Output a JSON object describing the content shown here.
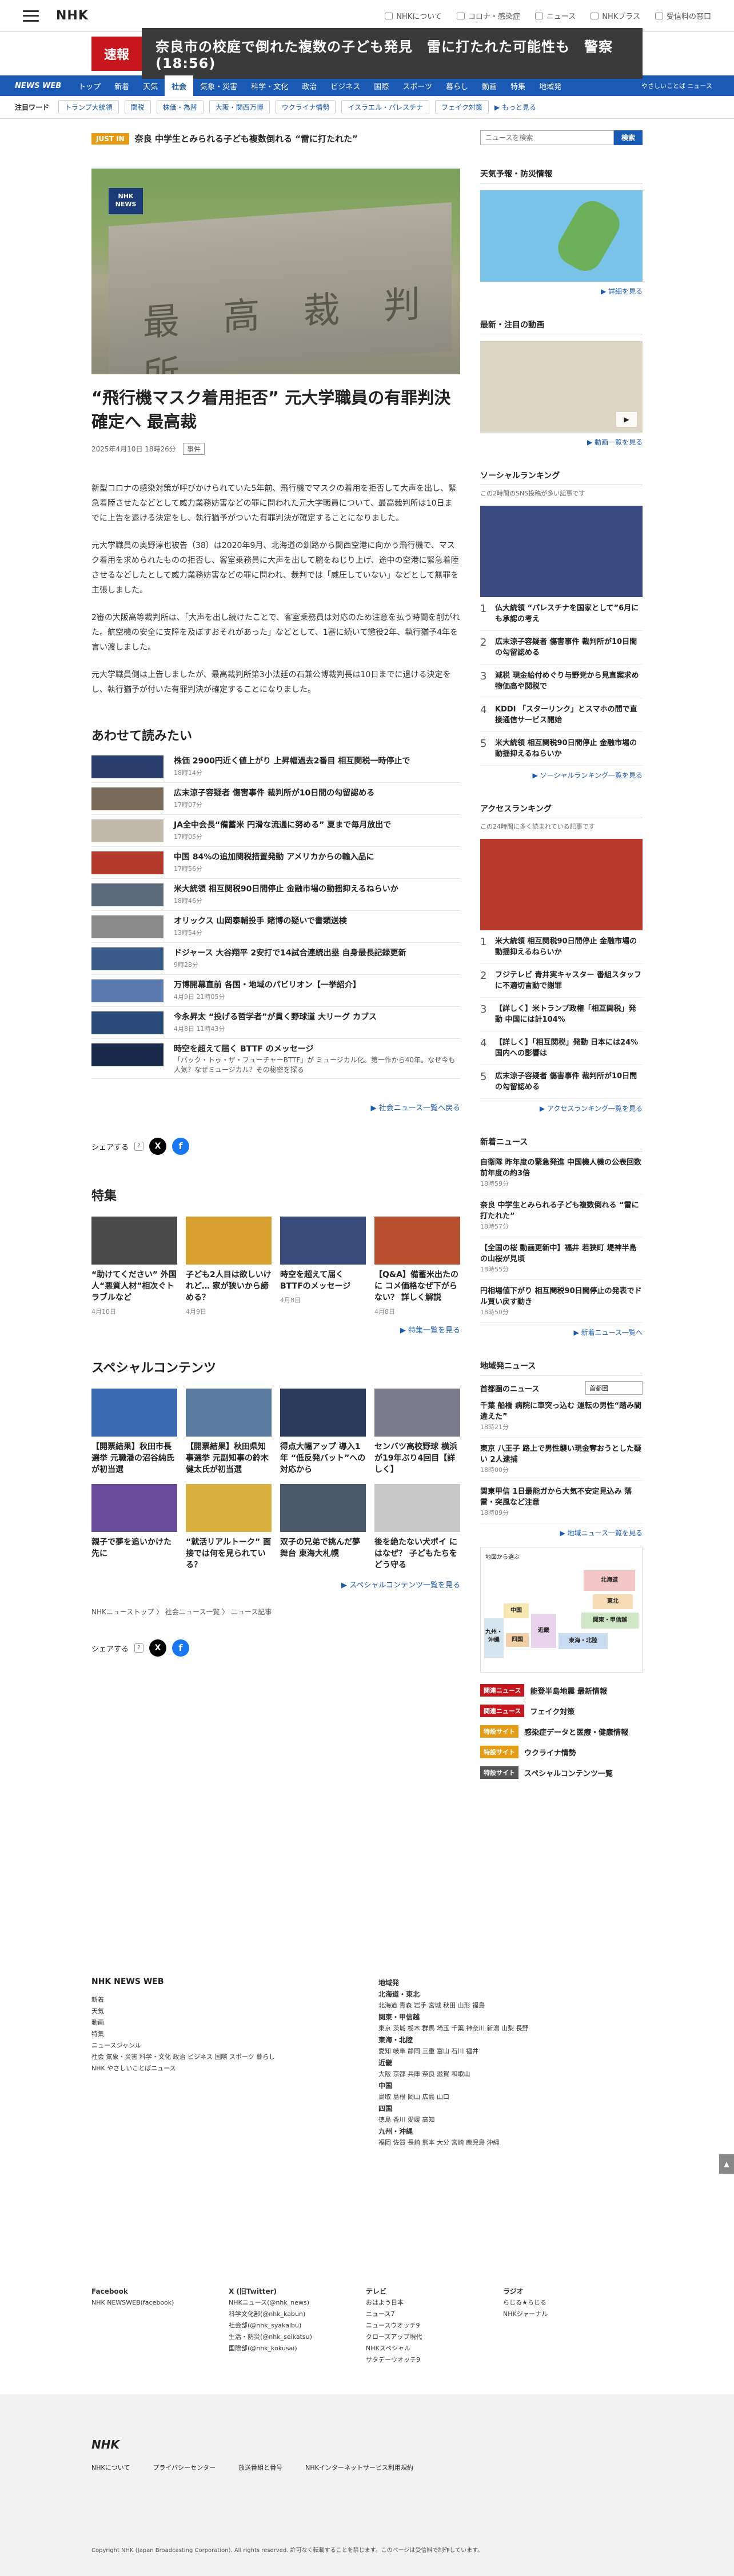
{
  "header": {
    "logo": "NHK",
    "links": [
      {
        "label": "NHKについて",
        "icon": "info-icon"
      },
      {
        "label": "コロナ・感染症",
        "icon": "virus-icon"
      },
      {
        "label": "ニュース",
        "icon": "news-icon"
      },
      {
        "label": "NHKプラス",
        "icon": "play-icon"
      },
      {
        "label": "受信料の窓口",
        "icon": "yen-icon"
      }
    ]
  },
  "breaking": {
    "tag": "速報",
    "text": "奈良市の校庭で倒れた複数の子ども発見　雷に打たれた可能性も　警察(18:56)"
  },
  "nav": {
    "brand": "NEWS WEB",
    "items": [
      "トップ",
      "新着",
      "天気",
      "社会",
      "気象・災害",
      "科学・文化",
      "政治",
      "ビジネス",
      "国際",
      "スポーツ",
      "暮らし",
      "動画",
      "特集",
      "地域発"
    ],
    "active": "社会",
    "last": "やさしいことば ニュース"
  },
  "keywords": {
    "label": "注目ワード",
    "items": [
      "トランプ大統領",
      "関税",
      "株価・為替",
      "大阪・関西万博",
      "ウクライナ情勢",
      "イスラエル・パレスチナ",
      "フェイク対策"
    ],
    "more": "▶ もっと見る"
  },
  "just_in": {
    "badge": "JUST IN",
    "text": "奈良 中学生とみられる子ども複数倒れる “雷に打たれた”"
  },
  "article": {
    "image_badge": "NHK NEWS",
    "image_chars": "最 高 裁 判 所",
    "title": "“飛行機マスク着用拒否” 元大学職員の有罪判決確定へ 最高裁",
    "date": "2025年4月10日 18時26分",
    "category": "事件",
    "paragraphs": [
      "新型コロナの感染対策が呼びかけられていた5年前、飛行機でマスクの着用を拒否して大声を出し、緊急着陸させたなどとして威力業務妨害などの罪に問われた元大学職員について、最高裁判所は10日までに上告を退ける決定をし、執行猶予がついた有罪判決が確定することになりました。",
      "元大学職員の奥野淳也被告（38）は2020年9月、北海道の釧路から関西空港に向かう飛行機で、マスク着用を求められたものの拒否し、客室乗務員に大声を出して腕をねじり上げ、途中の空港に緊急着陸させるなどしたとして威力業務妨害などの罪に問われ、裁判では「威圧していない」などとして無罪を主張しました。",
      "2審の大阪高等裁判所は、「大声を出し続けたことで、客室乗務員は対応のため注意を払う時間を削がれた。航空機の安全に支障を及ぼすおそれがあった」などとして、1審に続いて懲役2年、執行猶予4年を言い渡しました。",
      "元大学職員側は上告しましたが、最高裁判所第3小法廷の石兼公博裁判長は10日までに退ける決定をし、執行猶予が付いた有罪判決が確定することになりました。"
    ]
  },
  "related": {
    "heading": "あわせて読みたい",
    "items": [
      {
        "title": "株価 2900円近く値上がり 上昇幅過去2番目 相互関税一時停止で",
        "time": "18時14分",
        "color": "#2b3f6f"
      },
      {
        "title": "広末涼子容疑者 傷害事件 裁判所が10日間の勾留認める",
        "time": "17時07分",
        "color": "#7a6a5a"
      },
      {
        "title": "JA全中会長“備蓄米 円滑な流通に努める” 夏まで毎月放出で",
        "time": "17時05分",
        "color": "#c0b8a8"
      },
      {
        "title": "中国 84%の追加関税措置発動 アメリカからの輸入品に",
        "time": "17時56分",
        "color": "#b23a2a"
      },
      {
        "title": "米大統領 相互関税90日間停止 金融市場の動揺抑えるねらいか",
        "time": "18時46分",
        "color": "#5a6a7a"
      },
      {
        "title": "オリックス 山岡泰輔投手 賭博の疑いで書類送検",
        "time": "13時54分",
        "color": "#8a8a8a"
      },
      {
        "title": "ドジャース 大谷翔平 2安打で14試合連続出塁 自身最長記録更新",
        "time": "9時28分",
        "color": "#3a5a8a"
      },
      {
        "title": "万博開幕直前 各国・地域のパビリオン【一挙紹介】",
        "time": "4月9日 21時05分",
        "color": "#5a7ab0"
      },
      {
        "title": "今永昇太 “投げる哲学者”が貫く野球道 大リーグ カブス",
        "time": "4月8日 11時43分",
        "color": "#2a4a7a"
      },
      {
        "title": "時空を超えて届く BTTF のメッセージ",
        "time": "",
        "desc": "「バック・トゥ・ザ・フューチャーBTTF」が ミュージカル化。第一作から40年。なぜ今も人気？なぜミュージカル？その秘密を探る",
        "color": "#1a2a4a"
      }
    ],
    "more": "▶ 社会ニュース一覧へ戻る"
  },
  "share": {
    "label": "シェアする"
  },
  "features": {
    "heading": "特集",
    "items": [
      {
        "title": "“助けてください” 外国人“悪質人材”相次ぐトラブルなど",
        "date": "4月10日",
        "color": "#4a4a4a"
      },
      {
        "title": "子ども2人目は欲しいけれど… 家が狭いから諦める？",
        "date": "4月9日",
        "color": "#d8a030"
      },
      {
        "title": "時空を超えて届く BTTFのメッセージ",
        "date": "4月8日",
        "color": "#3a4a7a"
      },
      {
        "title": "【Q&A】備蓄米出たのに コメ価格なぜ下がらない？ 詳しく解説",
        "date": "4月8日",
        "color": "#b85030"
      }
    ],
    "more": "▶ 特集一覧を見る"
  },
  "special": {
    "heading": "スペシャルコンテンツ",
    "items": [
      {
        "title": "【開票結果】秋田市長選挙 元職潘の沼谷純氏が初当選",
        "color": "#3a6ab0"
      },
      {
        "title": "【開票結果】秋田県知事選挙 元副知事の鈴木健太氏が初当選",
        "color": "#5a7aa0"
      },
      {
        "title": "得点大幅アップ 導入1年 “低反発バット”への対応から",
        "color": "#2a3a5a"
      },
      {
        "title": "センバツ高校野球 横浜が19年ぶり4回目【詳しく】",
        "color": "#7a7a8a"
      },
      {
        "title": "親子で夢を追いかけた先に",
        "color": "#6a4a9a"
      },
      {
        "title": "“就活リアルトーク” 面接では何を見られている？",
        "color": "#d8b040"
      },
      {
        "title": "双子の兄弟で挑んだ夢舞台 東海大札幌",
        "color": "#4a5a6a"
      },
      {
        "title": "後を絶たない犬ポイ にはなぜ？ 子どもたちをどう守る",
        "color": "#c8c8c8"
      }
    ],
    "more": "▶ スペシャルコンテンツ一覧を見る"
  },
  "breadcrumb": [
    "NHKニューストップ",
    "社会ニュース一覧",
    "ニュース記事"
  ],
  "sidebar": {
    "search_placeholder": "ニュースを検索",
    "search_button": "検索",
    "weather": {
      "title": "天気予報・防災情報",
      "more": "▶ 詳細を見る"
    },
    "video": {
      "title": "最新・注目の動画",
      "more": "▶ 動画一覧を見る"
    },
    "social": {
      "title": "ソーシャルランキング",
      "sub": "この2時間のSNS投稿が多い記事です",
      "items": [
        "仏大統領 “パレスチナを国家として”6月にも承認の考え",
        "広末涼子容疑者 傷害事件 裁判所が10日間の勾留認める",
        "減税 現金給付めぐり与野党から見直案求め 物価高や関税で",
        "KDDI 「スターリンク」とスマホの間で直接通信サービス開始",
        "米大統領 相互関税90日間停止 金融市場の動揺抑えるねらいか"
      ],
      "more": "▶ ソーシャルランキング一覧を見る"
    },
    "access": {
      "title": "アクセスランキング",
      "sub": "この24時間に多く読まれている記事です",
      "items": [
        "米大統領 相互関税90日間停止 金融市場の動揺抑えるねらいか",
        "フジテレビ 青井実キャスター 番組スタッフに不適切言動で謝罪",
        "【詳しく】米トランプ政権「相互関税」発動 中国には計104%",
        "【詳しく】「相互関税」発動 日本には24% 国内への影響は",
        "広末涼子容疑者 傷害事件 裁判所が10日間の勾留認める"
      ],
      "more": "▶ アクセスランキング一覧を見る"
    },
    "newest": {
      "title": "新着ニュース",
      "items": [
        {
          "title": "自衛隊 昨年度の緊急発進 中国機人機の公表回数 前年度の約3倍",
          "time": "18時59分"
        },
        {
          "title": "奈良 中学生とみられる子ども複数倒れる “雷に打たれた”",
          "time": "18時57分"
        },
        {
          "title": "【全国の桜 動画更新中】福井 若狭町 堤神半島の山桜が見頃",
          "time": "18時55分"
        },
        {
          "title": "円相場値下がり 相互関税90日間停止の発表でドル買い戻す動き",
          "time": "18時50分"
        }
      ],
      "more": "▶ 新着ニュース一覧へ"
    },
    "local": {
      "title": "地域発ニュース",
      "label": "首都圏のニュース",
      "select": "首都圏",
      "items": [
        {
          "title": "千葉 船橋 病院に車突っ込む 運転の男性“踏み間違えた”",
          "time": "18時21分"
        },
        {
          "title": "東京 八王子 路上で男性襲い現金奪おうとした疑い 2人逮捕",
          "time": "18時00分"
        },
        {
          "title": "関東甲信 1日最能ガから大気不安定見込み 落雷・突風など注意",
          "time": "18時09分"
        }
      ],
      "more": "▶ 地域ニュース一覧を見る",
      "map_label": "地図から選ぶ",
      "regions": [
        "北海道",
        "東北",
        "関東・甲信越",
        "東海・北陸",
        "近畿",
        "中国",
        "四国",
        "九州・沖縄"
      ]
    },
    "banners": [
      {
        "badge": "関連ニュース",
        "text": "能登半島地震 最新情報",
        "color": "#c8161d"
      },
      {
        "badge": "関連ニュース",
        "text": "フェイク対策",
        "color": "#c8161d"
      },
      {
        "badge": "特設サイト",
        "text": "感染症データと医療・健康情報",
        "color": "#e59b12"
      },
      {
        "badge": "特設サイト",
        "text": "ウクライナ情勢",
        "color": "#e59b12"
      },
      {
        "badge": "特設サイト",
        "text": "スペシャルコンテンツ一覧",
        "color": "#555"
      }
    ]
  },
  "footer": {
    "brand": "NHK NEWS WEB",
    "col1": [
      "新着",
      "天気",
      "動画",
      "特集",
      "ニュースジャンル",
      "社会 気象・災害 科学・文化 政治 ビジネス 国際 スポーツ 暮らし",
      "NHK やさしいことばニュース"
    ],
    "areas_title": "地域発",
    "areas": [
      "北海道・東北",
      "北海道 青森 岩手 宮城 秋田 山形 福島",
      "関東・甲信越",
      "東京 茨城 栃木 群馬 埼玉 千葉 神奈川 新潟 山梨 長野",
      "東海・北陸",
      "愛知 岐阜 静岡 三重 富山 石川 福井",
      "近畿",
      "大阪 京都 兵庫 奈良 滋賀 和歌山",
      "中国",
      "鳥取 島根 岡山 広島 山口",
      "四国",
      "徳島 香川 愛媛 高知",
      "九州・沖縄",
      "福岡 佐賀 長崎 熊本 大分 宮崎 鹿児島 沖縄"
    ],
    "sns": [
      {
        "h": "Facebook",
        "items": [
          "NHK NEWSWEB(facebook)"
        ]
      },
      {
        "h": "X (旧Twitter)",
        "items": [
          "NHKニュース(@nhk_news)",
          "科学文化部(@nhk_kabun)",
          "社会部(@nhk_syakaibu)",
          "生活・防災(@nhk_seikatsu)",
          "国際部(@nhk_kokusai)"
        ]
      },
      {
        "h": "テレビ",
        "items": [
          "おはよう日本",
          "ニュース7",
          "ニュースウオッチ9",
          "クローズアップ現代",
          "NHKスペシャル",
          "サタデーウオッチ9"
        ]
      },
      {
        "h": "ラジオ",
        "items": [
          "らじる★らじる",
          "NHKジャーナル"
        ]
      }
    ],
    "logo": "NHK",
    "bottom_links": [
      "NHKについて",
      "プライバシーセンター",
      "放送番組と番号",
      "NHKインターネットサービス利用規約"
    ],
    "copyright": "Copyright NHK (Japan Broadcasting Corporation). All rights reserved. 許可なく転載することを禁じます。このページは受信料で制作しています。"
  }
}
